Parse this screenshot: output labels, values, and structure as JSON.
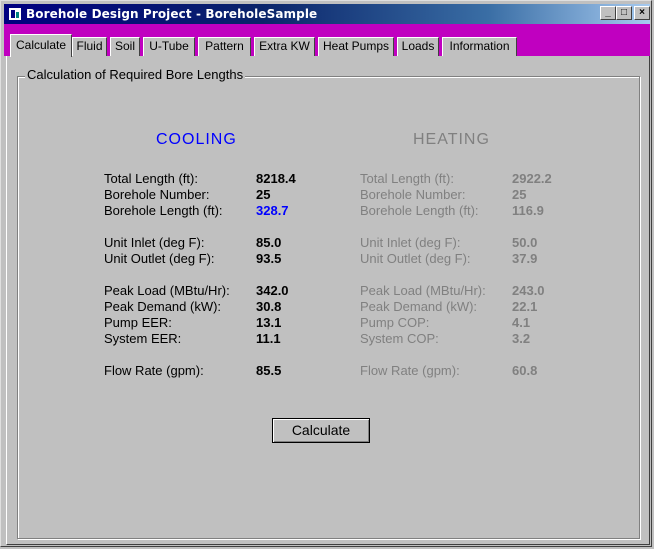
{
  "window": {
    "title": "Borehole Design Project - BoreholeSample",
    "minimize": "_",
    "maximize": "□",
    "close": "×"
  },
  "tabs": [
    "Calculate",
    "Fluid",
    "Soil",
    "U-Tube",
    "Pattern",
    "Extra KW",
    "Heat Pumps",
    "Loads",
    "Information"
  ],
  "active_tab": "Calculate",
  "group_title": "Calculation of Required Bore Lengths",
  "cooling": {
    "heading": "COOLING",
    "rows": [
      {
        "label": "Total Length (ft):",
        "value": "8218.4"
      },
      {
        "label": "Borehole Number:",
        "value": "25"
      },
      {
        "label": "Borehole Length (ft):",
        "value": "328.7"
      },
      {
        "label": "Unit Inlet (deg F):",
        "value": "85.0"
      },
      {
        "label": "Unit Outlet (deg F):",
        "value": "93.5"
      },
      {
        "label": "Peak Load (MBtu/Hr):",
        "value": "342.0"
      },
      {
        "label": "Peak Demand (kW):",
        "value": "30.8"
      },
      {
        "label": "Pump EER:",
        "value": "13.1"
      },
      {
        "label": "System EER:",
        "value": "11.1"
      },
      {
        "label": "Flow Rate (gpm):",
        "value": "85.5"
      }
    ]
  },
  "heating": {
    "heading": "HEATING",
    "rows": [
      {
        "label": "Total Length (ft):",
        "value": "2922.2"
      },
      {
        "label": "Borehole Number:",
        "value": "25"
      },
      {
        "label": "Borehole Length (ft):",
        "value": "116.9"
      },
      {
        "label": "Unit Inlet (deg F):",
        "value": "50.0"
      },
      {
        "label": "Unit Outlet (deg F):",
        "value": "37.9"
      },
      {
        "label": "Peak Load (MBtu/Hr):",
        "value": "243.0"
      },
      {
        "label": "Peak Demand (kW):",
        "value": "22.1"
      },
      {
        "label": "Pump COP:",
        "value": "4.1"
      },
      {
        "label": "System COP:",
        "value": "3.2"
      },
      {
        "label": "Flow Rate (gpm):",
        "value": "60.8"
      }
    ]
  },
  "calculate_button": "Calculate",
  "colors": {
    "accent_cooling": "#0000ff",
    "disabled_text": "#808080",
    "tab_strip": "#c000c0"
  }
}
